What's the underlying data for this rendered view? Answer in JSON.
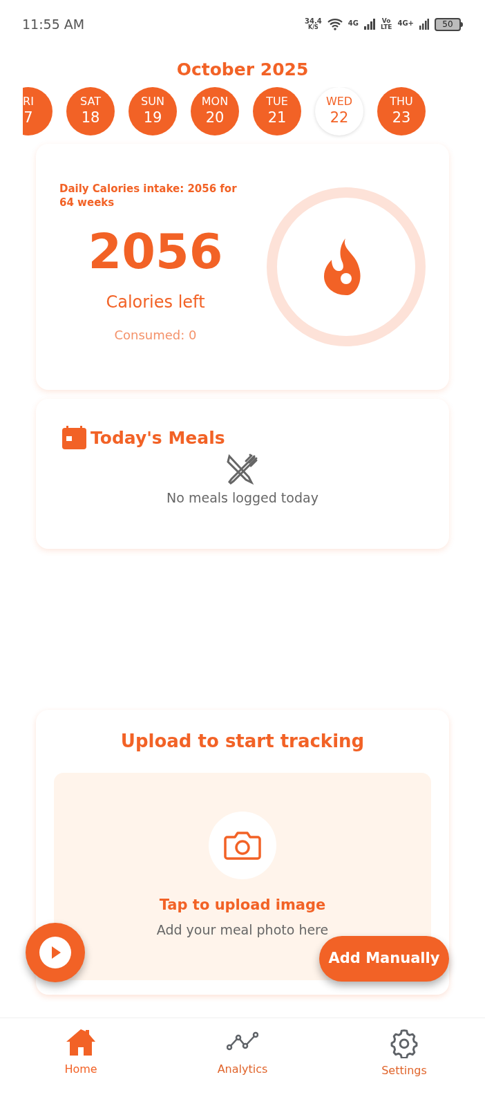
{
  "status_bar": {
    "time": "11:55 AM",
    "speed": "34.4",
    "speed_unit": "K/S",
    "network_1": "4G",
    "volte": "Vo",
    "volte_sub": "LTE",
    "network_2": "4G+",
    "battery": "50"
  },
  "month": "October 2025",
  "days": [
    {
      "day": "RI",
      "date": "7",
      "selected": false
    },
    {
      "day": "SAT",
      "date": "18",
      "selected": false
    },
    {
      "day": "SUN",
      "date": "19",
      "selected": false
    },
    {
      "day": "MON",
      "date": "20",
      "selected": false
    },
    {
      "day": "TUE",
      "date": "21",
      "selected": false
    },
    {
      "day": "WED",
      "date": "22",
      "selected": true
    },
    {
      "day": "THU",
      "date": "23",
      "selected": false
    }
  ],
  "calories_card": {
    "intake_note": "Daily Calories intake: 2056 for 64 weeks",
    "value": "2056",
    "label": "Calories left",
    "consumed": "Consumed: 0"
  },
  "meals_card": {
    "title": "Today's Meals",
    "empty_text": "No meals logged today"
  },
  "upload_card": {
    "title": "Upload to start tracking",
    "action": "Tap to upload image",
    "hint": "Add your meal photo here"
  },
  "add_manually": "Add Manually",
  "bottom_nav": [
    {
      "kind": "home",
      "label": "Home",
      "selected": true
    },
    {
      "kind": "analytics",
      "label": "Analytics",
      "selected": false
    },
    {
      "kind": "settings",
      "label": "Settings",
      "selected": false
    }
  ]
}
